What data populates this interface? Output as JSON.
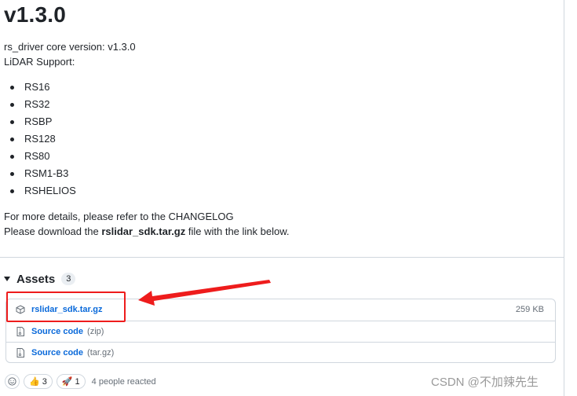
{
  "release": {
    "title": "v1.3.0",
    "core_version_line": "rs_driver core version: v1.3.0",
    "lidar_support_heading": "LiDAR Support:",
    "lidar_models": [
      "RS16",
      "RS32",
      "RSBP",
      "RS128",
      "RS80",
      "RSM1-B3",
      "RSHELIOS"
    ],
    "details_line": "For more details, please refer to the CHANGELOG",
    "download_prefix": "Please download the ",
    "download_file": "rslidar_sdk.tar.gz",
    "download_suffix": " file with the link below."
  },
  "assets": {
    "label": "Assets",
    "count": "3",
    "items": [
      {
        "name": "rslidar_sdk.tar.gz",
        "suffix": "",
        "size": "259 KB",
        "icon": "package-icon"
      },
      {
        "name": "Source code",
        "suffix": "(zip)",
        "size": "",
        "icon": "file-zip-icon"
      },
      {
        "name": "Source code",
        "suffix": "(tar.gz)",
        "size": "",
        "icon": "file-zip-icon"
      }
    ]
  },
  "reactions": {
    "thumbs_up_count": "3",
    "rocket_count": "1",
    "summary": "4 people reacted"
  },
  "annotation": {
    "highlight_color": "#ee1c1c"
  },
  "watermark": "CSDN @不加辣先生"
}
